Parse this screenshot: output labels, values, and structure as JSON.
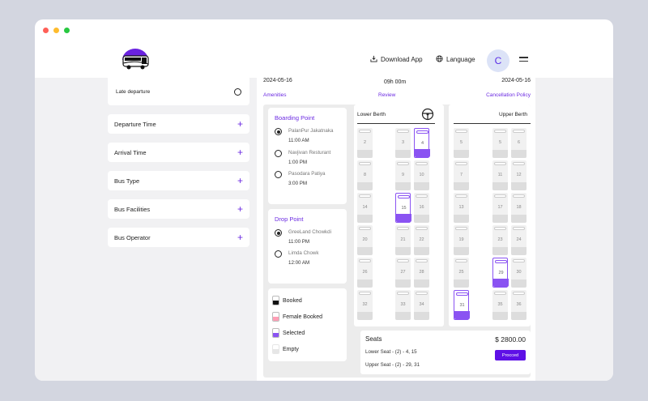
{
  "window": {
    "dot_colors": [
      "#ff5f57",
      "#febc2e",
      "#28c840"
    ]
  },
  "header": {
    "logo_icon": "bus-logo-icon",
    "download_label": "Download App",
    "language_label": "Language",
    "avatar_initial": "C"
  },
  "filters": {
    "late_departure": "Late departure",
    "items": [
      "Departure Time",
      "Arrival Time",
      "Bus Type",
      "Bus Facilities",
      "Bus Operator"
    ]
  },
  "trip": {
    "depart_date": "2024-05-16",
    "duration": "09h 00m",
    "arrive_date": "2024-05-16"
  },
  "links": {
    "amenities": "Amenities",
    "review": "Review",
    "cancellation": "Cancellation Policy"
  },
  "boarding": {
    "title": "Boarding Point",
    "stops": [
      {
        "name": "PalanPur Jakatnaka",
        "time": "11:00 AM",
        "selected": true
      },
      {
        "name": "Navjivan Resturant",
        "time": "1:00 PM",
        "selected": false
      },
      {
        "name": "Pasodara Patiya",
        "time": "3:00 PM",
        "selected": false
      }
    ]
  },
  "drop": {
    "title": "Drop Point",
    "stops": [
      {
        "name": "GreeLand Chowkdi",
        "time": "11:00 PM",
        "selected": true
      },
      {
        "name": "Limda Chowk",
        "time": "12:00 AM",
        "selected": false
      }
    ]
  },
  "legend": {
    "items": [
      {
        "label": "Booked",
        "color": "#111111"
      },
      {
        "label": "Female Booked",
        "color": "#ff9eb5"
      },
      {
        "label": "Selected",
        "color": "#8a53f2"
      },
      {
        "label": "Empty",
        "color": "#e6e6e6"
      }
    ]
  },
  "lower_berth": {
    "title": "Lower Berth",
    "rows": [
      {
        "left": "2",
        "mid": "3",
        "right": "4"
      },
      {
        "left": "8",
        "mid": "9",
        "right": "10"
      },
      {
        "left": "14",
        "mid": "15",
        "right": "16"
      },
      {
        "left": "20",
        "mid": "21",
        "right": "22"
      },
      {
        "left": "26",
        "mid": "27",
        "right": "28"
      },
      {
        "left": "32",
        "mid": "33",
        "right": "34"
      }
    ],
    "selected": [
      "4",
      "15"
    ]
  },
  "upper_berth": {
    "title": "Upper Berth",
    "rows": [
      {
        "left": "5",
        "mid": "5",
        "right": "6"
      },
      {
        "left": "7",
        "mid": "11",
        "right": "12"
      },
      {
        "left": "13",
        "mid": "17",
        "right": "18"
      },
      {
        "left": "19",
        "mid": "23",
        "right": "24"
      },
      {
        "left": "25",
        "mid": "29",
        "right": "30"
      },
      {
        "left": "31",
        "mid": "35",
        "right": "36"
      }
    ],
    "selected": [
      "29",
      "31"
    ]
  },
  "summary": {
    "title": "Seats",
    "price": "$ 2800.00",
    "lower": "Lower Seat -   (2) - 4, 15",
    "upper": "Upper Seat -   (2) - 29, 31",
    "proceed_label": "Procced"
  }
}
